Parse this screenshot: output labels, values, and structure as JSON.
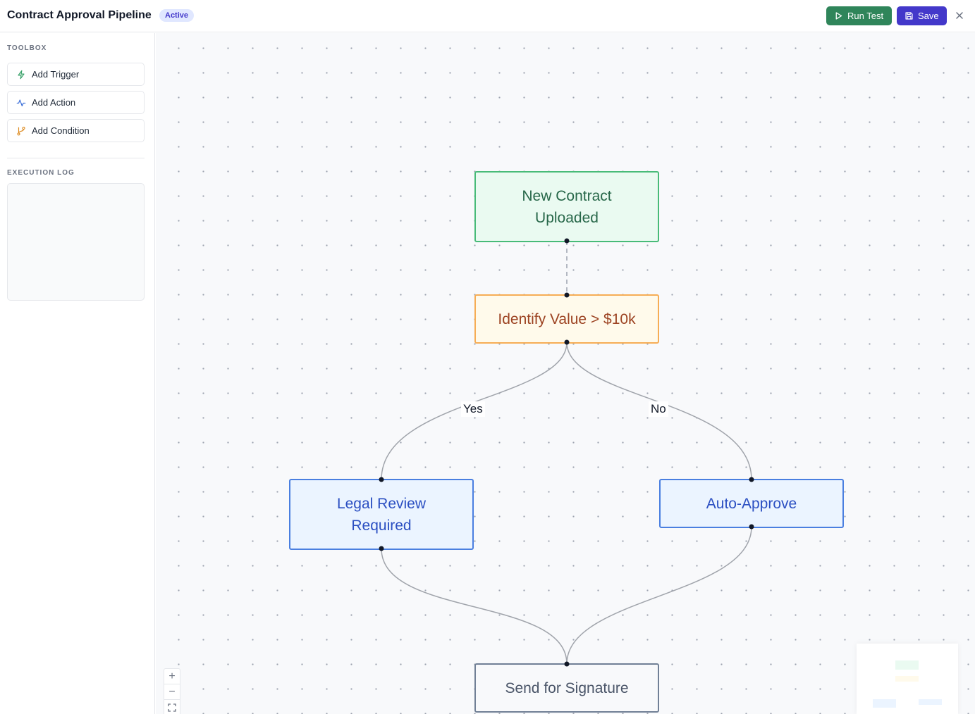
{
  "header": {
    "title": "Contract Approval Pipeline",
    "status_badge": "Active",
    "run_test_label": "Run Test",
    "save_label": "Save"
  },
  "sidebar": {
    "toolbox_label": "TOOLBOX",
    "tools": [
      {
        "label": "Add Trigger",
        "icon": "lightning-icon"
      },
      {
        "label": "Add Action",
        "icon": "activity-icon"
      },
      {
        "label": "Add Condition",
        "icon": "branch-icon"
      }
    ],
    "execution_log_label": "EXECUTION LOG"
  },
  "canvas": {
    "nodes": {
      "trigger": {
        "line1": "New Contract",
        "line2": "Uploaded"
      },
      "condition": {
        "label": "Identify Value > $10k"
      },
      "legal": {
        "line1": "Legal Review",
        "line2": "Required"
      },
      "auto": {
        "label": "Auto-Approve"
      },
      "signature": {
        "label": "Send for Signature"
      }
    },
    "edge_labels": {
      "yes": "Yes",
      "no": "No"
    },
    "zoom_controls": {
      "in": "+",
      "out": "−"
    }
  },
  "colors": {
    "trigger": "#48bb78",
    "condition": "#f6ad55",
    "action": "#4a7fe0",
    "end": "#718096",
    "run_button": "#2f855a",
    "save_button": "#4338ca"
  }
}
